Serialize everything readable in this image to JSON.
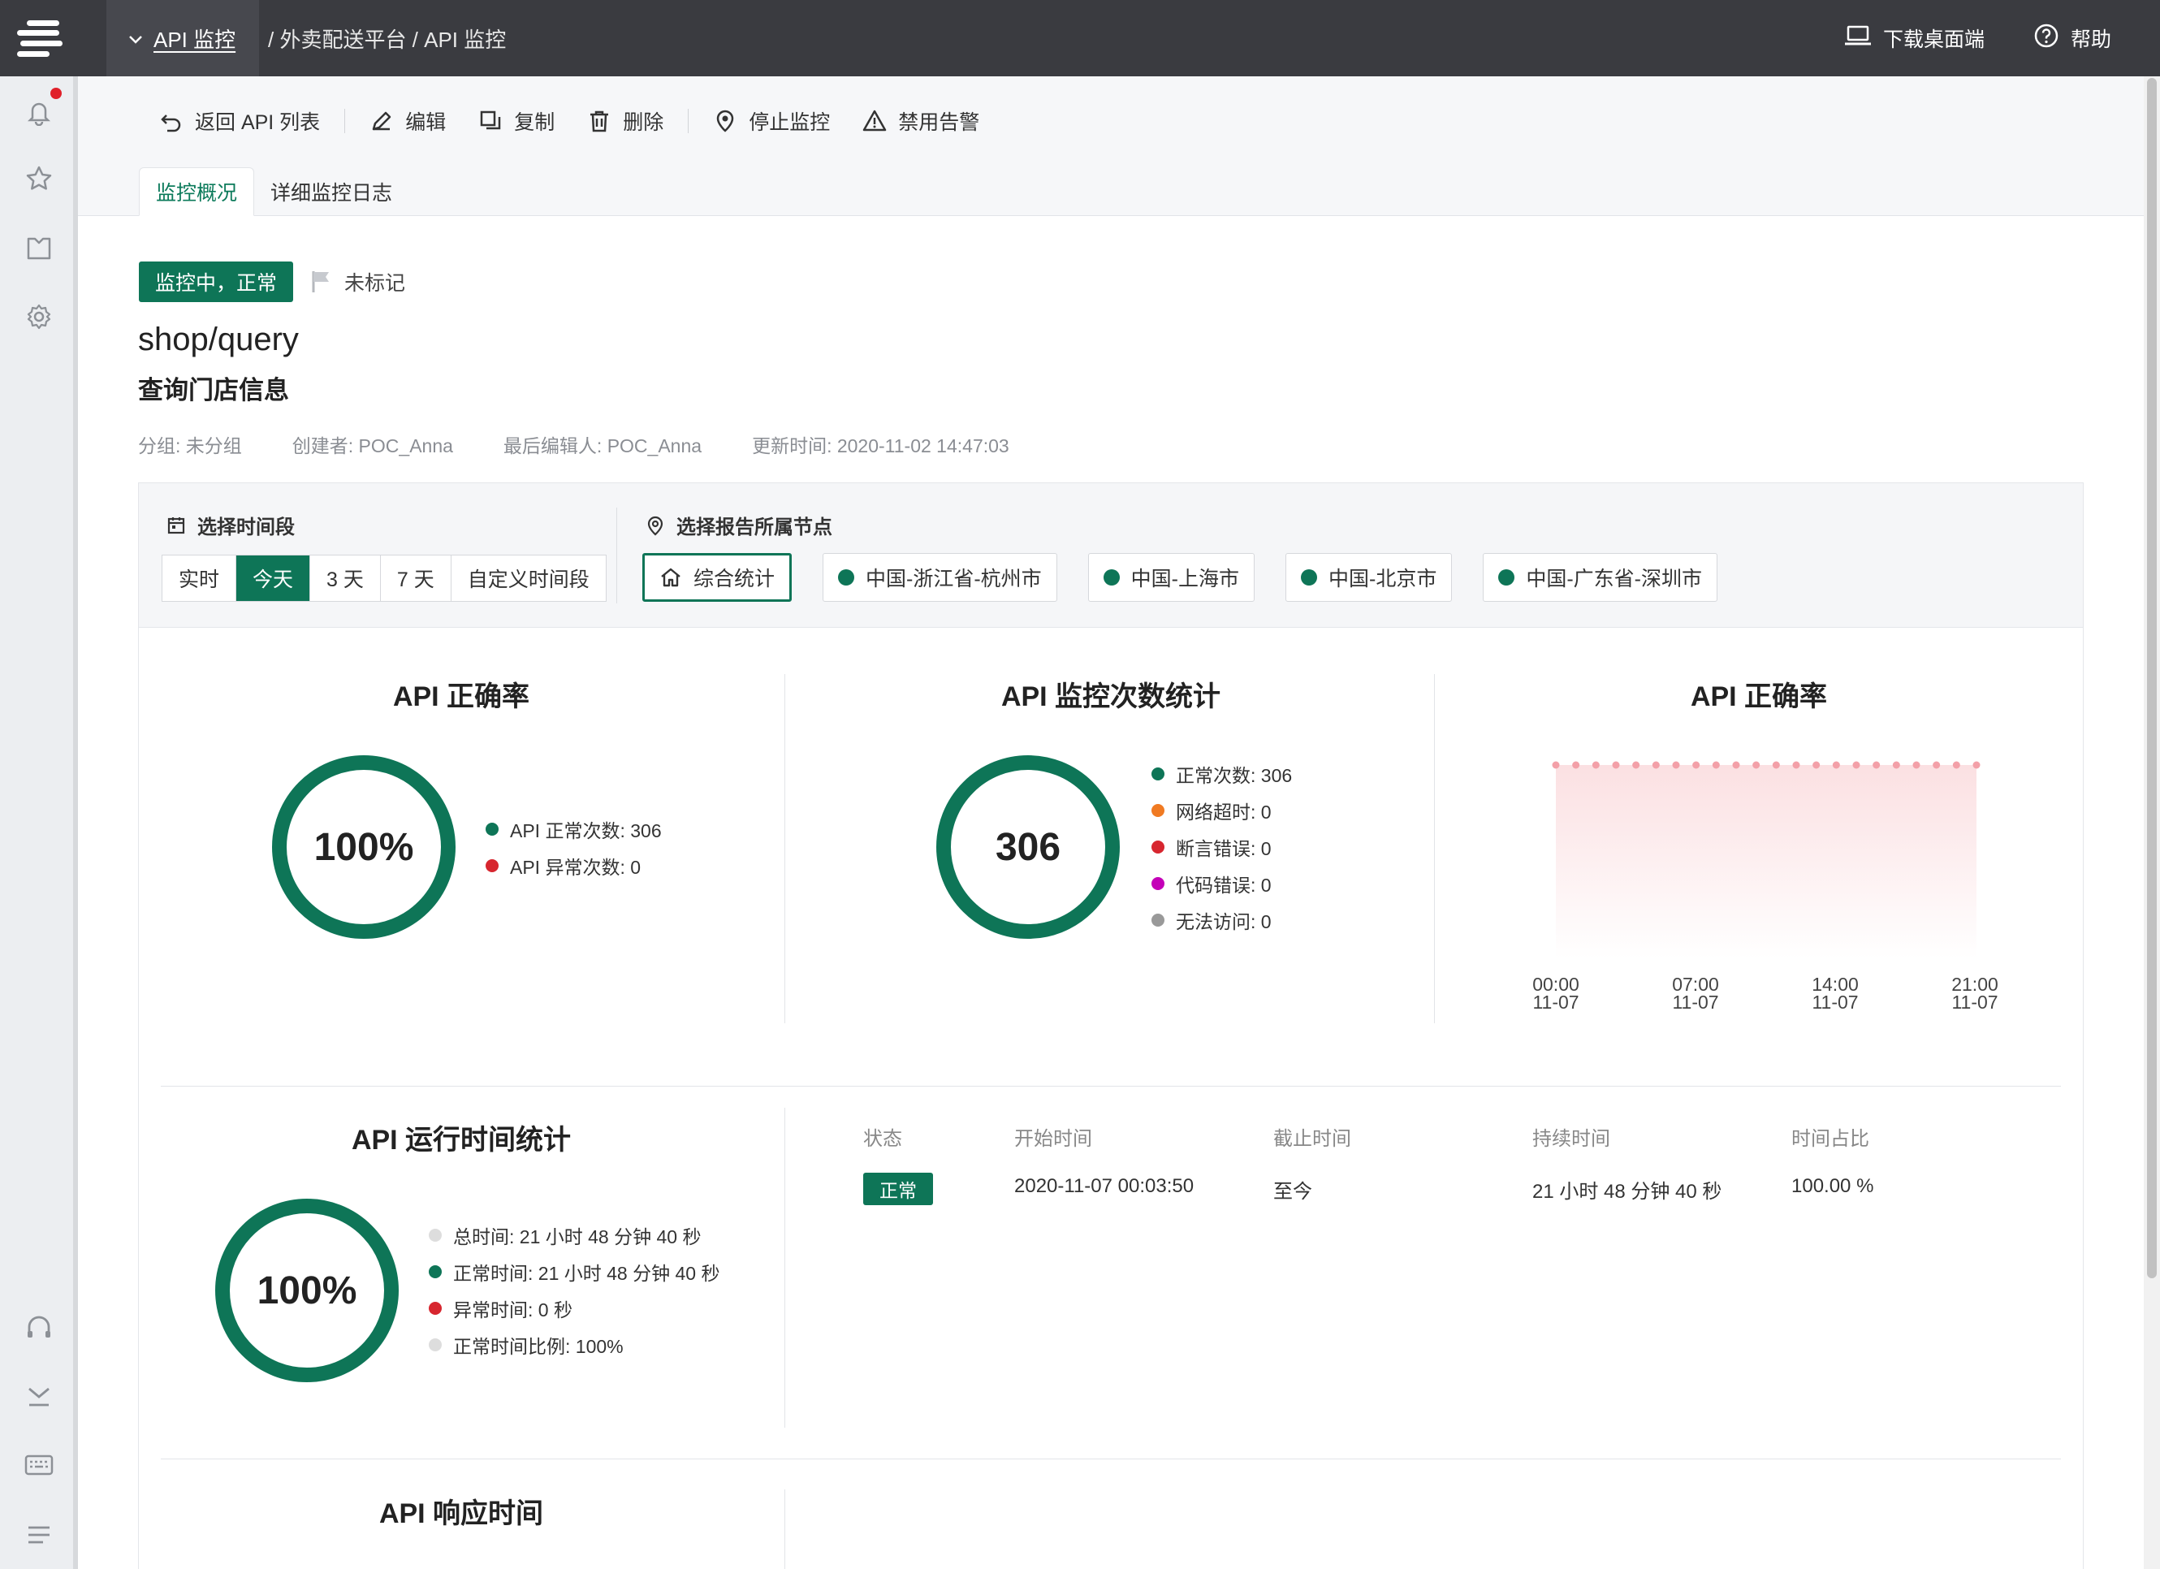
{
  "topbar": {
    "module": "API 监控",
    "path": "/ 外卖配送平台 / API 监控",
    "download": "下载桌面端",
    "help": "帮助"
  },
  "toolbar": {
    "back": "返回 API 列表",
    "edit": "编辑",
    "copy": "复制",
    "delete": "删除",
    "stop": "停止监控",
    "disable_alert": "禁用告警"
  },
  "tabs": [
    "监控概况",
    "详细监控日志"
  ],
  "status": {
    "badge": "监控中，正常",
    "flag": "未标记"
  },
  "api": {
    "path": "shop/query",
    "name": "查询门店信息",
    "group": "分组: 未分组",
    "creator": "创建者: POC_Anna",
    "editor": "最后编辑人: POC_Anna",
    "updated": "更新时间:  2020-11-02 14:47:03"
  },
  "filter": {
    "time_title": "选择时间段",
    "time_options": [
      "实时",
      "今天",
      "3 天",
      "7 天",
      "自定义时间段"
    ],
    "time_selected": "今天",
    "node_title": "选择报告所属节点",
    "nodes": [
      "综合统计",
      "中国-浙江省-杭州市",
      "中国-上海市",
      "中国-北京市",
      "中国-广东省-深圳市"
    ]
  },
  "accuracy": {
    "title": "API 正确率",
    "value": "100%",
    "normal": "API 正常次数:  306",
    "abnormal": "API 异常次数:  0"
  },
  "count": {
    "title": "API 监控次数统计",
    "value": "306",
    "items": [
      "正常次数:  306",
      "网络超时:  0",
      "断言错误:  0",
      "代码错误:  0",
      "无法访问:  0"
    ]
  },
  "trend": {
    "title": "API 正确率",
    "x_labels": [
      [
        "00:00",
        "11-07"
      ],
      [
        "07:00",
        "11-07"
      ],
      [
        "14:00",
        "11-07"
      ],
      [
        "21:00",
        "11-07"
      ]
    ]
  },
  "uptime": {
    "title": "API 运行时间统计",
    "value": "100%",
    "items": [
      "总时间:  21 小时 48 分钟 40 秒",
      "正常时间:  21 小时 48 分钟 40 秒",
      "异常时间:  0 秒",
      "正常时间比例:  100%"
    ]
  },
  "table": {
    "headers": [
      "状态",
      "开始时间",
      "截止时间",
      "持续时间",
      "时间占比"
    ],
    "row": {
      "status": "正常",
      "start": "2020-11-07 00:03:50",
      "end": "至今",
      "duration": "21 小时 48 分钟 40 秒",
      "ratio": "100.00 %"
    }
  },
  "response": {
    "title": "API 响应时间"
  },
  "colors": {
    "accent": "#0e7557",
    "error": "#d7262f",
    "timeout": "#f07a22",
    "code_error": "#c400b8",
    "unreachable": "#999999",
    "chart_dots": "#f3a0a8"
  },
  "chart_data": {
    "type": "area",
    "title": "API 正确率",
    "x": [
      "00:00 11-07",
      "07:00 11-07",
      "14:00 11-07",
      "21:00 11-07"
    ],
    "series": [
      {
        "values": [
          100,
          100,
          100,
          100,
          100,
          100,
          100,
          100,
          100,
          100,
          100,
          100,
          100,
          100,
          100,
          100,
          100,
          100,
          100,
          100,
          100,
          100
        ]
      }
    ],
    "ylim": [
      0,
      100
    ],
    "grid": false
  }
}
